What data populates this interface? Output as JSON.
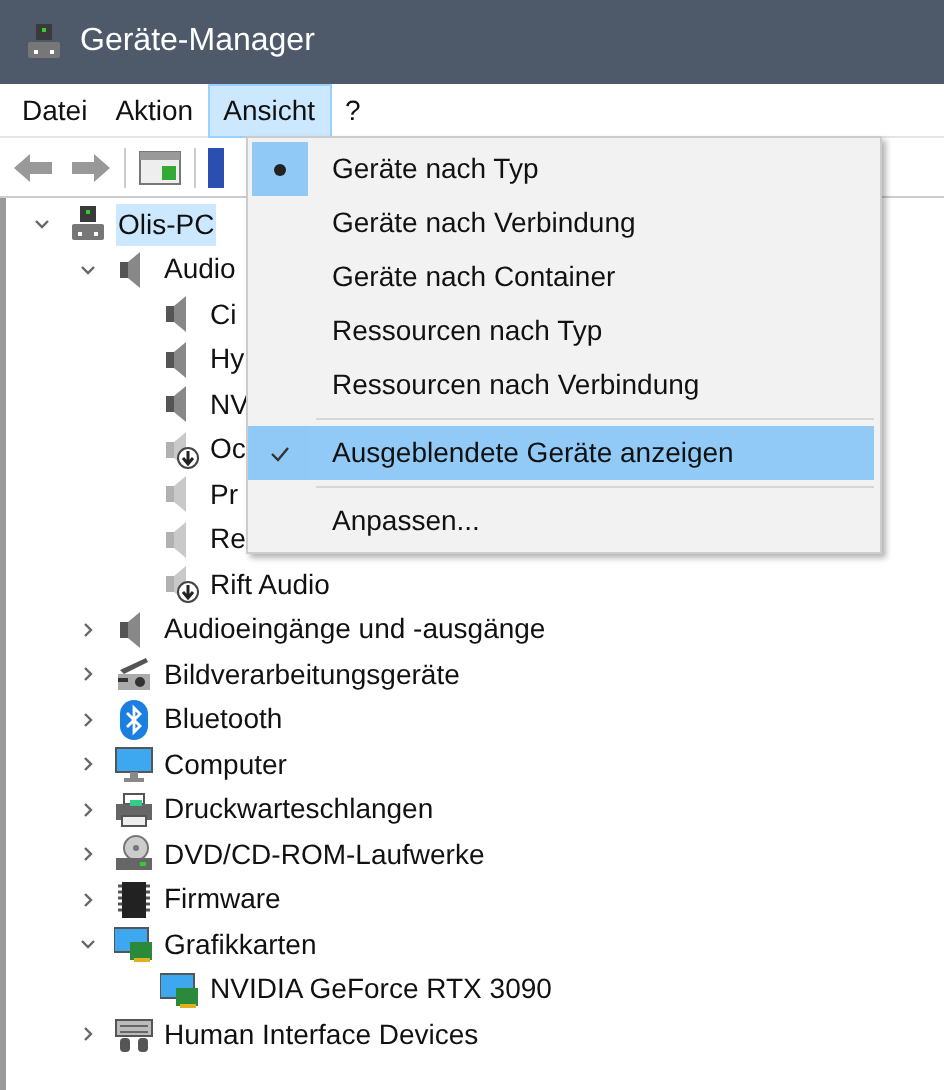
{
  "window": {
    "title": "Geräte-Manager"
  },
  "menu_bar": [
    {
      "label": "Datei",
      "selected": false
    },
    {
      "label": "Aktion",
      "selected": false
    },
    {
      "label": "Ansicht",
      "selected": true
    },
    {
      "label": "?",
      "selected": false
    }
  ],
  "tree": [
    {
      "label": "Olis-PC",
      "kind": "computer",
      "expanded": true,
      "selected": true,
      "children": [
        {
          "label": "Audio",
          "kind": "speaker",
          "expanded": true,
          "selected": false,
          "children": [
            {
              "label": "Ci",
              "kind": "speaker",
              "selected": false
            },
            {
              "label": "Hy",
              "kind": "speaker",
              "selected": false
            },
            {
              "label": "NV",
              "kind": "speaker",
              "selected": false
            },
            {
              "label": "Oc",
              "kind": "speaker-disabled",
              "selected": false
            },
            {
              "label": "Pr",
              "kind": "speaker-hidden",
              "selected": false
            },
            {
              "label": "Re",
              "kind": "speaker-hidden",
              "selected": false
            },
            {
              "label": "Rift Audio",
              "kind": "speaker-disabled",
              "selected": false
            }
          ]
        },
        {
          "label": "Audioeingänge und -ausgänge",
          "kind": "speaker",
          "expanded": false,
          "selected": false
        },
        {
          "label": "Bildverarbeitungsgeräte",
          "kind": "camera",
          "expanded": false,
          "selected": false
        },
        {
          "label": "Bluetooth",
          "kind": "bluetooth",
          "expanded": false,
          "selected": false
        },
        {
          "label": "Computer",
          "kind": "monitor",
          "expanded": false,
          "selected": false
        },
        {
          "label": "Druckwarteschlangen",
          "kind": "printer",
          "expanded": false,
          "selected": false
        },
        {
          "label": "DVD/CD-ROM-Laufwerke",
          "kind": "dvd",
          "expanded": false,
          "selected": false
        },
        {
          "label": "Firmware",
          "kind": "chip",
          "expanded": false,
          "selected": false
        },
        {
          "label": "Grafikkarten",
          "kind": "display-adapter",
          "expanded": true,
          "selected": false,
          "children": [
            {
              "label": "NVIDIA GeForce RTX 3090",
              "kind": "display-adapter",
              "selected": false
            }
          ]
        },
        {
          "label": "Human Interface Devices",
          "kind": "keyboard",
          "expanded": false,
          "selected": false
        }
      ]
    }
  ],
  "view_menu": [
    {
      "kind": "radio",
      "label": "Geräte nach Typ",
      "checked": true,
      "highlighted": false
    },
    {
      "kind": "radio",
      "label": "Geräte nach Verbindung",
      "checked": false,
      "highlighted": false
    },
    {
      "kind": "radio",
      "label": "Geräte nach Container",
      "checked": false,
      "highlighted": false
    },
    {
      "kind": "radio",
      "label": "Ressourcen nach Typ",
      "checked": false,
      "highlighted": false
    },
    {
      "kind": "radio",
      "label": "Ressourcen nach Verbindung",
      "checked": false,
      "highlighted": false
    },
    {
      "kind": "separator"
    },
    {
      "kind": "check",
      "label": "Ausgeblendete Geräte anzeigen",
      "checked": true,
      "highlighted": true
    },
    {
      "kind": "separator"
    },
    {
      "kind": "item",
      "label": "Anpassen..."
    }
  ]
}
